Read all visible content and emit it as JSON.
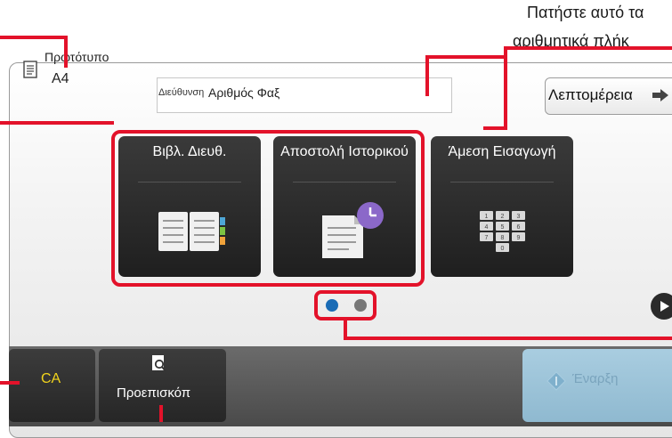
{
  "callouts": {
    "top_right_line1": "Πατήστε αυτό τα",
    "top_right_line2": "αριθμητικά πλήκ"
  },
  "original": {
    "label": "Πρωτότυπο",
    "size": "A4"
  },
  "address": {
    "label": "Διεύθυνση",
    "value": "Αριθμός Φαξ"
  },
  "details_button": {
    "label": "Λεπτομέρεια"
  },
  "tiles": [
    {
      "label": "Βιβλ. Διευθ.",
      "icon": "address-book-icon"
    },
    {
      "label": "Αποστολή Ιστορικού",
      "icon": "send-history-icon"
    },
    {
      "label": "Άμεση Εισαγωγή",
      "icon": "keypad-icon"
    }
  ],
  "keypad_keys": [
    "1",
    "2",
    "3",
    "4",
    "5",
    "6",
    "7",
    "8",
    "9",
    "0"
  ],
  "pagination": {
    "current_page": 1,
    "total_pages": 2,
    "active_color": "#1a6bb5",
    "inactive_color": "#777777"
  },
  "bottom": {
    "ca_label": "CA",
    "preview_label": "Προεπισκόπ",
    "start_label": "Έναρξη"
  },
  "colors": {
    "callout_red": "#e3122a",
    "tile_bg": "#2b2b2b",
    "ca_text": "#f1d41c",
    "start_bg": "#9fc7dc"
  }
}
